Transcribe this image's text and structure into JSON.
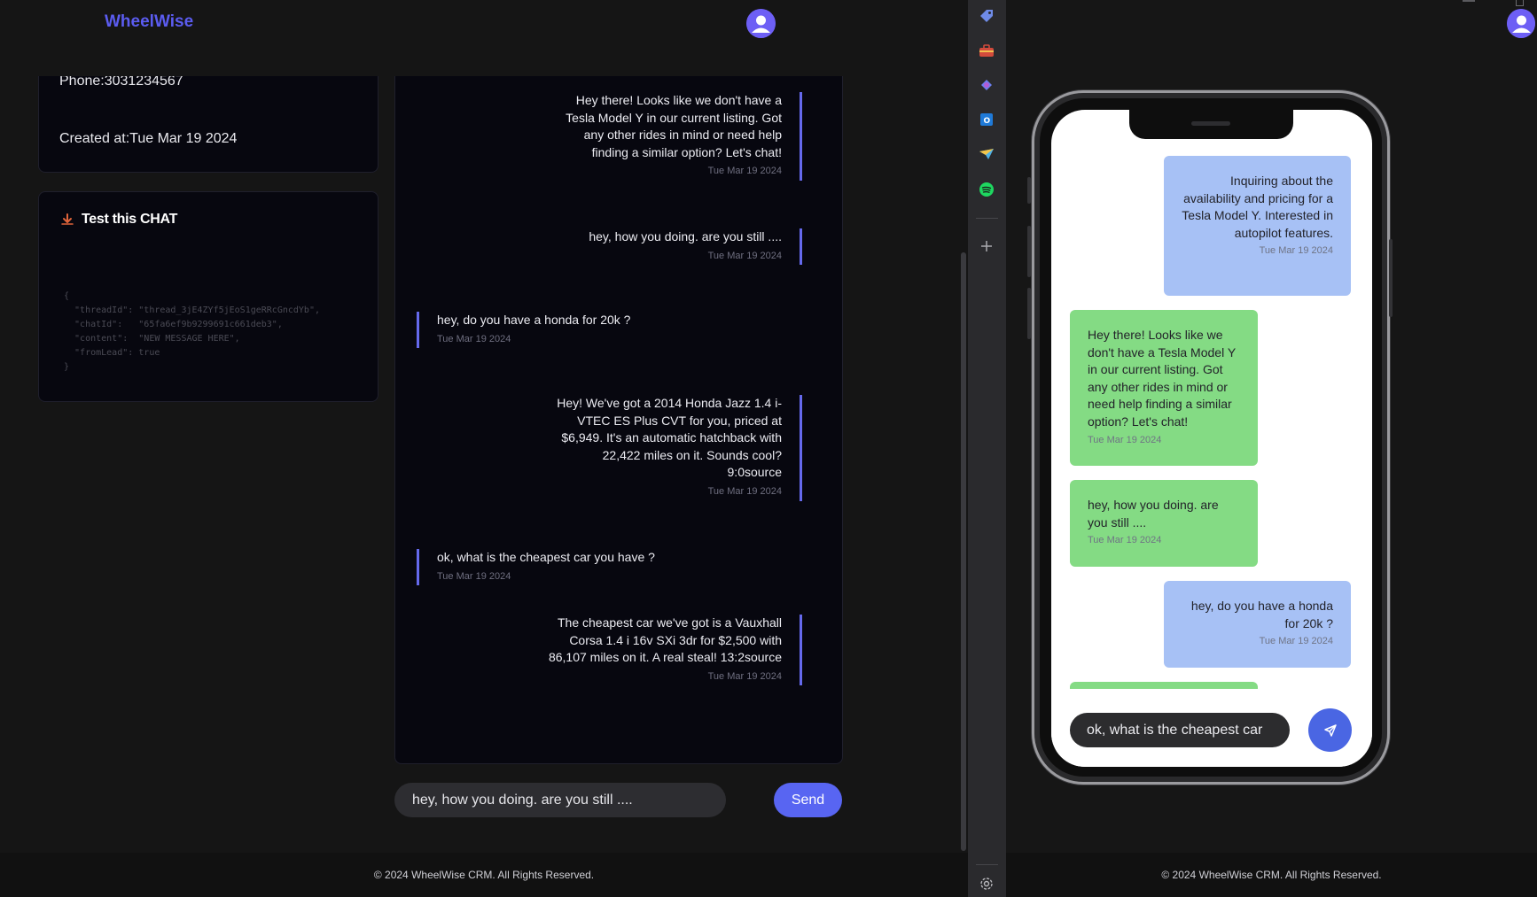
{
  "app": {
    "brand": "WheelWise"
  },
  "lead_info": {
    "phone": "Phone:3031234567",
    "created": "Created at:Tue Mar 19 2024"
  },
  "test_chat": {
    "title": "Test this CHAT",
    "code": "{\n  \"threadId\": \"thread_3jE4ZYf5jEoS1geRRcGncdYb\",\n  \"chatId\":   \"65fa6ef9b9299691c661deb3\",\n  \"content\":  \"NEW MESSAGE HERE\",\n  \"fromLead\": true\n}"
  },
  "chat": {
    "messages": [
      {
        "role": "bot",
        "text": "Hey there! Looks like we don't have a Tesla Model Y in our current listing. Got any other rides in mind or need help finding a similar option? Let's chat!",
        "time": "Tue Mar 19 2024"
      },
      {
        "role": "bot",
        "text": "hey, how you doing. are you still ....",
        "time": "Tue Mar 19 2024"
      },
      {
        "role": "user",
        "text": "hey, do you have a honda for 20k ?",
        "time": "Tue Mar 19 2024"
      },
      {
        "role": "bot",
        "text": "Hey! We've got a 2014 Honda Jazz 1.4 i-VTEC ES Plus CVT for you, priced at $6,949. It's an automatic hatchback with 22,422 miles on it. Sounds cool? 9:0source",
        "time": "Tue Mar 19 2024"
      },
      {
        "role": "user",
        "text": "ok, what is the cheapest car you have ?",
        "time": "Tue Mar 19 2024"
      },
      {
        "role": "bot",
        "text": "The cheapest car we've got is a Vauxhall Corsa 1.4 i 16v SXi 3dr for $2,500 with 86,107 miles on it. A real steal! 13:2source",
        "time": "Tue Mar 19 2024"
      }
    ],
    "input_value": "hey, how you doing. are you still ....",
    "send_label": "Send"
  },
  "footer": {
    "text": "© 2024 WheelWise CRM. All Rights Reserved."
  },
  "phone": {
    "messages": [
      {
        "role": "user",
        "text": "Inquiring about the availability and pricing for a Tesla Model Y. Interested in autopilot features.",
        "time": "Tue Mar 19 2024"
      },
      {
        "role": "bot",
        "text": "Hey there! Looks like we don't have a Tesla Model Y in our current listing. Got any other rides in mind or need help finding a similar option? Let's chat!",
        "time": "Tue Mar 19 2024"
      },
      {
        "role": "bot",
        "text": "hey, how you doing. are you still ....",
        "time": "Tue Mar 19 2024"
      },
      {
        "role": "user",
        "text": "hey, do you have a honda for 20k ?",
        "time": "Tue Mar 19 2024"
      }
    ],
    "input_value": "ok, what is the cheapest car"
  },
  "sidebar": {
    "icons": [
      "tag-icon",
      "toolbox-icon",
      "copilot-icon",
      "outlook-icon",
      "send-icon",
      "spotify-icon",
      "add-icon",
      "settings-icon"
    ]
  },
  "colors": {
    "accent": "#5865f2",
    "brand": "#5b5cf0",
    "user_bubble": "#a7c1f5",
    "bot_bubble": "#84db84",
    "chat_border": "#6569ec"
  }
}
